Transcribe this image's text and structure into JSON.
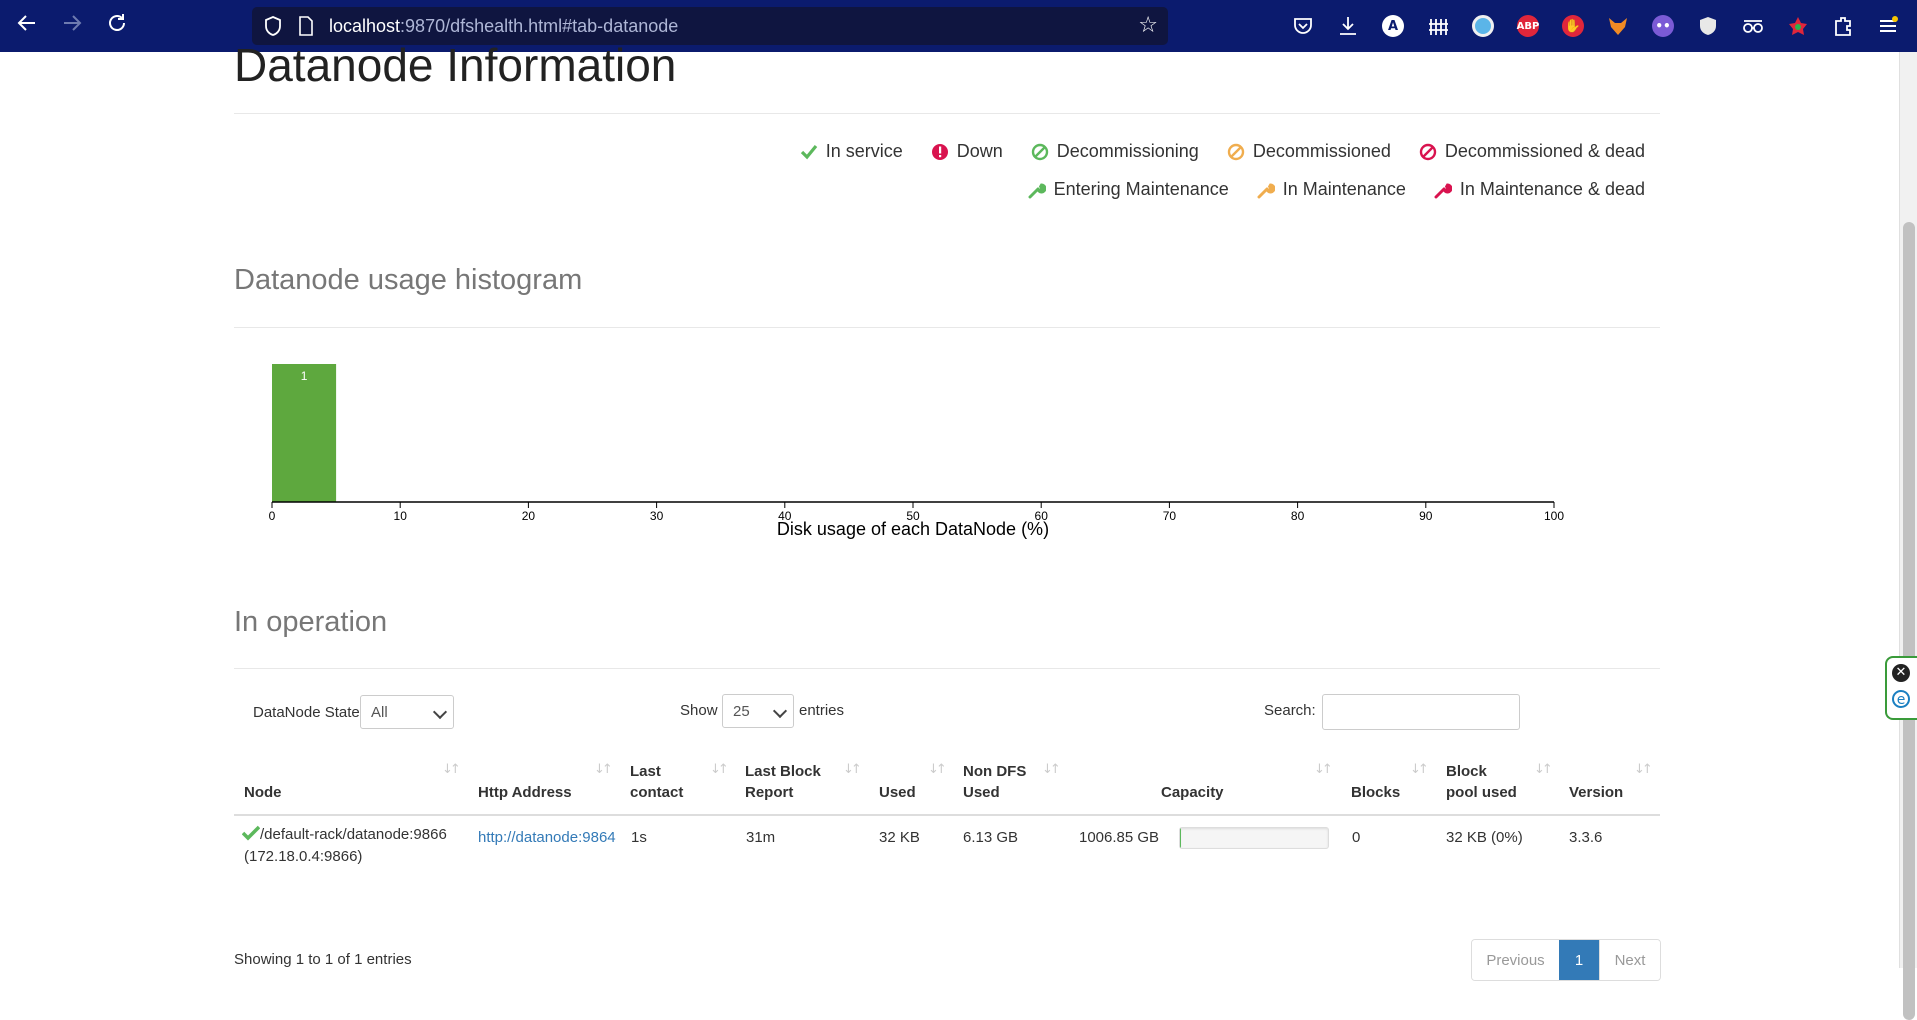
{
  "browser": {
    "url_host": "localhost",
    "url_rest": ":9870/dfshealth.html#tab-datanode",
    "back_icon": "arrow-left-icon",
    "forward_icon": "arrow-right-icon",
    "reload_icon": "reload-icon"
  },
  "extensions": {
    "adblock_label": "ABP",
    "a_label": "A"
  },
  "page": {
    "title": "Datanode Information",
    "legend": {
      "row1": [
        {
          "label": "In service",
          "icon": "check-icon",
          "color": "#5cb85c"
        },
        {
          "label": "Down",
          "icon": "exclamation-icon",
          "color": "#d9134f"
        },
        {
          "label": "Decommissioning",
          "icon": "ban-icon",
          "color": "#5cb85c"
        },
        {
          "label": "Decommissioned",
          "icon": "ban-icon",
          "color": "#f0ad4e"
        },
        {
          "label": "Decommissioned & dead",
          "icon": "ban-icon",
          "color": "#d9134f"
        }
      ],
      "row2": [
        {
          "label": "Entering Maintenance",
          "icon": "wrench-icon",
          "color": "#5cb85c"
        },
        {
          "label": "In Maintenance",
          "icon": "wrench-icon",
          "color": "#f0ad4e"
        },
        {
          "label": "In Maintenance & dead",
          "icon": "wrench-icon",
          "color": "#d9134f"
        }
      ]
    },
    "histogram_heading": "Datanode usage histogram",
    "operation_heading": "In operation"
  },
  "chart_data": {
    "type": "bar",
    "xlabel": "Disk usage of each DataNode (%)",
    "xlim": [
      0,
      100
    ],
    "xticks": [
      0,
      10,
      20,
      30,
      40,
      50,
      60,
      70,
      80,
      90,
      100
    ],
    "bins": [
      {
        "x0": 0,
        "x1": 5,
        "count": 1
      }
    ],
    "bar_color": "#5ea83e",
    "grid": false
  },
  "table_controls": {
    "state_label": "DataNode State",
    "state_value": "All",
    "show_label": "Show",
    "entries_value": "25",
    "entries_label": "entries",
    "search_label": "Search:",
    "search_value": ""
  },
  "table": {
    "headers": {
      "node": "Node",
      "http": "Http Address",
      "last_contact_1": "Last",
      "last_contact_2": "contact",
      "last_block_1": "Last Block",
      "last_block_2": "Report",
      "used": "Used",
      "non_dfs_1": "Non DFS",
      "non_dfs_2": "Used",
      "capacity": "Capacity",
      "blocks": "Blocks",
      "pool_1": "Block",
      "pool_2": "pool used",
      "version": "Version"
    },
    "rows": [
      {
        "node_line1": "/default-rack/datanode:9866",
        "node_line2": "(172.18.0.4:9866)",
        "http": "http://datanode:9864",
        "last_contact": "1s",
        "last_block": "31m",
        "used": "32 KB",
        "non_dfs": "6.13 GB",
        "capacity": "1006.85 GB",
        "capacity_used_fraction": 0.006,
        "blocks": "0",
        "pool_used": "32 KB (0%)",
        "version": "3.3.6"
      }
    ],
    "info": "Showing 1 to 1 of 1 entries",
    "pager": {
      "previous": "Previous",
      "page": "1",
      "next": "Next"
    }
  }
}
